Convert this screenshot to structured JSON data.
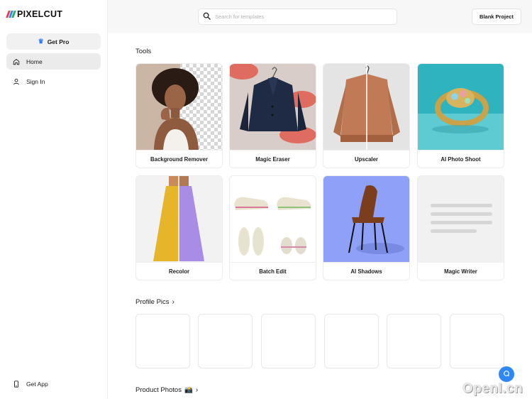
{
  "brand": {
    "name": "PIXELCUT",
    "colors": [
      "#ef3a4a",
      "#2f86f6",
      "#20b06a"
    ]
  },
  "sidebar": {
    "get_pro_label": "Get Pro",
    "items": [
      {
        "label": "Home",
        "icon": "home-icon"
      },
      {
        "label": "Sign In",
        "icon": "user-icon"
      }
    ],
    "get_app_label": "Get App"
  },
  "header": {
    "search_placeholder": "Search for templates",
    "blank_project_label": "Blank Project"
  },
  "sections": {
    "tools_title": "Tools",
    "profile_pics_title": "Profile Pics",
    "product_photos_title": "Product Photos",
    "product_photos_emoji": "📸"
  },
  "tools": [
    {
      "label": "Background Remover",
      "icon": "background-remover-thumb"
    },
    {
      "label": "Magic Eraser",
      "icon": "magic-eraser-thumb"
    },
    {
      "label": "Upscaler",
      "icon": "upscaler-thumb"
    },
    {
      "label": "AI Photo Shoot",
      "icon": "ai-photo-shoot-thumb"
    },
    {
      "label": "Recolor",
      "icon": "recolor-thumb"
    },
    {
      "label": "Batch Edit",
      "icon": "batch-edit-thumb"
    },
    {
      "label": "AI Shadows",
      "icon": "ai-shadows-thumb"
    },
    {
      "label": "Magic Writer",
      "icon": "magic-writer-thumb"
    }
  ],
  "watermark": "OpenI.cn",
  "accent_color": "#2f86f6"
}
